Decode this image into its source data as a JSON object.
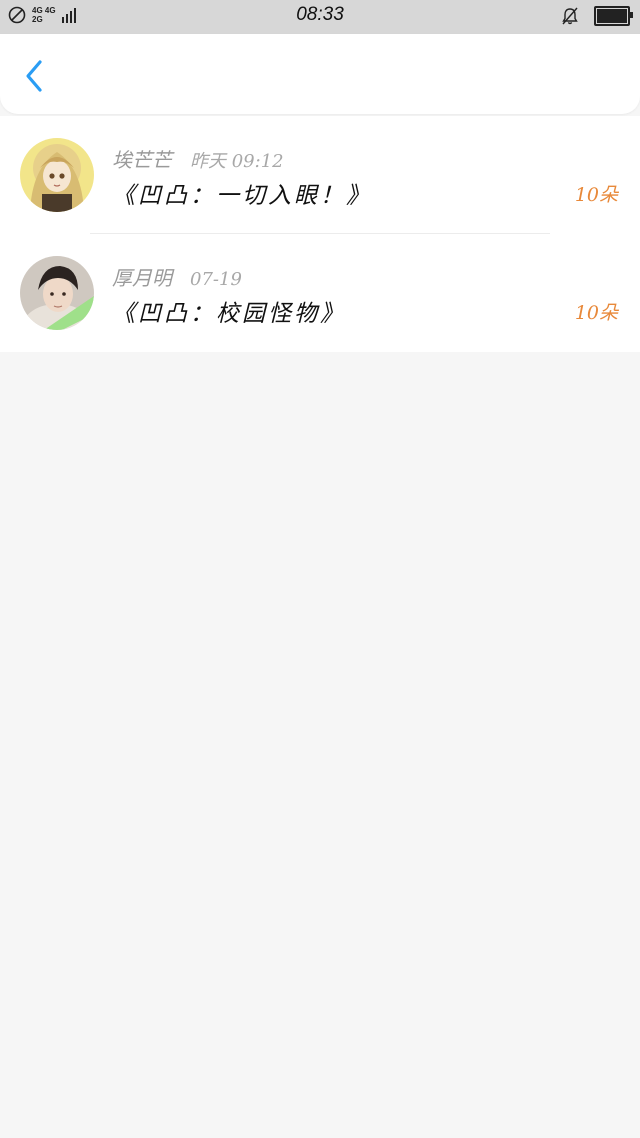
{
  "status_bar": {
    "network_top": "4G 4G",
    "network_bottom": "2G",
    "time": "08:33"
  },
  "header": {
    "back_icon": "chevron-left-icon",
    "accent_color": "#2a9df4"
  },
  "messages": [
    {
      "sender": "埃芒芒",
      "time": "昨天 09:12",
      "title": "《凹凸：一切入眼！》",
      "count": "10朵"
    },
    {
      "sender": "厚月明",
      "time": "07-19",
      "title": "《凹凸：校园怪物》",
      "count": "10朵"
    }
  ],
  "colors": {
    "count": "#e8893a",
    "background": "#f6f6f6",
    "status_bar": "#d7d7d7"
  }
}
